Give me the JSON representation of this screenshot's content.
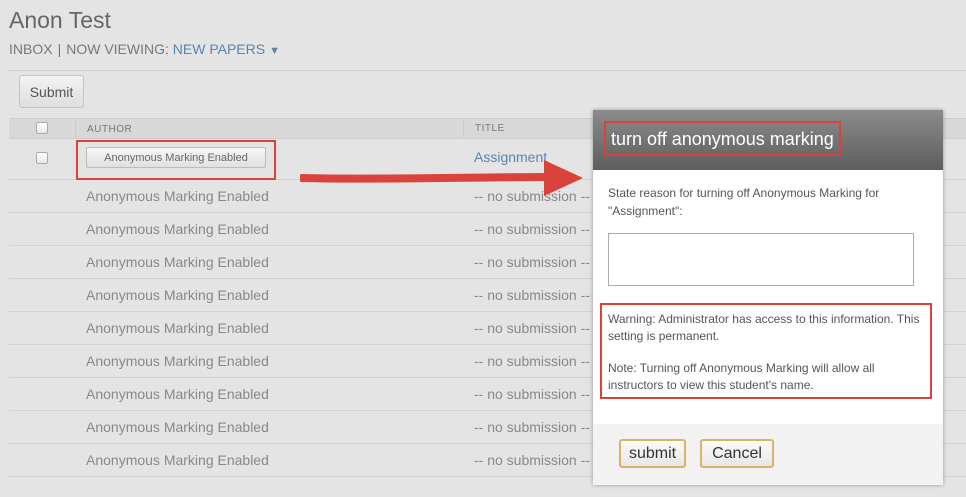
{
  "header": {
    "title": "Anon Test",
    "inbox_label": "INBOX",
    "separator": "|",
    "viewing_label": "NOW VIEWING:",
    "viewing_value": "NEW PAPERS",
    "caret": "▼"
  },
  "toolbar": {
    "submit_label": "Submit"
  },
  "table": {
    "columns": {
      "author": "AUTHOR",
      "title": "TITLE"
    },
    "first_row": {
      "author_button": "Anonymous Marking Enabled",
      "title": "Assignment"
    },
    "rows": [
      {
        "author": "Anonymous Marking Enabled",
        "title": "-- no submission --"
      },
      {
        "author": "Anonymous Marking Enabled",
        "title": "-- no submission --"
      },
      {
        "author": "Anonymous Marking Enabled",
        "title": "-- no submission --"
      },
      {
        "author": "Anonymous Marking Enabled",
        "title": "-- no submission --"
      },
      {
        "author": "Anonymous Marking Enabled",
        "title": "-- no submission --"
      },
      {
        "author": "Anonymous Marking Enabled",
        "title": "-- no submission --"
      },
      {
        "author": "Anonymous Marking Enabled",
        "title": "-- no submission --"
      },
      {
        "author": "Anonymous Marking Enabled",
        "title": "-- no submission --"
      },
      {
        "author": "Anonymous Marking Enabled",
        "title": "-- no submission --"
      }
    ]
  },
  "dialog": {
    "title": "turn off anonymous marking",
    "reason_label": "State reason for turning off Anonymous Marking for \"Assignment\":",
    "reason_value": "",
    "warning": "Warning: Administrator has access to this information. This setting is permanent.",
    "note": "Note: Turning off Anonymous Marking will allow all instructors to view this student's name.",
    "submit_label": "submit",
    "cancel_label": "Cancel"
  },
  "colors": {
    "highlight": "#d9433b",
    "link": "#5b84ad",
    "button_border": "#d8b36a"
  }
}
